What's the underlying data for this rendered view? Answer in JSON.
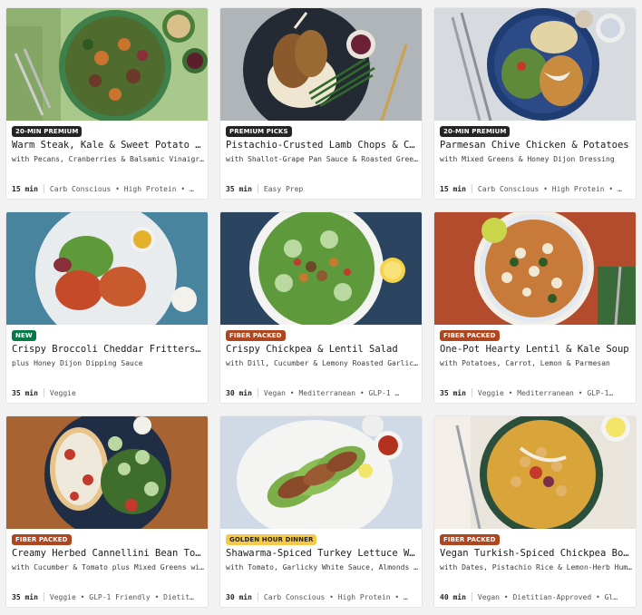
{
  "cards": [
    {
      "badge": "20-MIN PREMIUM",
      "badge_type": "premium",
      "title": "Warm Steak, Kale & Sweet Potato Salad",
      "subtitle": "with Pecans, Cranberries & Balsamic Vinaigrette",
      "time": "15 min",
      "tags": "Carb Conscious • High Protein • …",
      "image_icon": "salad-bowl-image"
    },
    {
      "badge": "PREMIUM PICKS",
      "badge_type": "premium",
      "title": "Pistachio-Crusted Lamb Chops & Cream…",
      "subtitle": "with Shallot-Grape Pan Sauce & Roasted Green Beans",
      "time": "35 min",
      "tags": "Easy Prep",
      "image_icon": "lamb-chops-plate-image"
    },
    {
      "badge": "20-MIN PREMIUM",
      "badge_type": "premium",
      "title": "Parmesan Chive Chicken & Potatoes",
      "subtitle": "with Mixed Greens & Honey Dijon Dressing",
      "time": "15 min",
      "tags": "Carb Conscious • High Protein • …",
      "image_icon": "chicken-potatoes-plate-image"
    },
    {
      "badge": "NEW",
      "badge_type": "new",
      "title": "Crispy Broccoli Cheddar Fritters with Ra…",
      "subtitle": "plus Honey Dijon Dipping Sauce",
      "time": "35 min",
      "tags": "Veggie",
      "image_icon": "fritters-plate-image"
    },
    {
      "badge": "FIBER PACKED",
      "badge_type": "fiber",
      "title": "Crispy Chickpea & Lentil Salad",
      "subtitle": "with Dill, Cucumber & Lemony Roasted Garlic Vinai…",
      "time": "30 min",
      "tags": "Vegan • Mediterranean • GLP-1 …",
      "image_icon": "chickpea-salad-bowl-image"
    },
    {
      "badge": "FIBER PACKED",
      "badge_type": "fiber",
      "title": "One-Pot Hearty Lentil & Kale Soup",
      "subtitle": "with Potatoes, Carrot, Lemon & Parmesan",
      "time": "35 min",
      "tags": "Veggie • Mediterranean • GLP-1…",
      "image_icon": "lentil-soup-bowl-image"
    },
    {
      "badge": "FIBER PACKED",
      "badge_type": "fiber",
      "title": "Creamy Herbed Cannellini Bean Toasts",
      "subtitle": "with Cucumber & Tomato plus Mixed Greens with Pi…",
      "time": "35 min",
      "tags": "Veggie • GLP-1 Friendly • Dietit…",
      "image_icon": "bean-toasts-plate-image"
    },
    {
      "badge": "GOLDEN HOUR DINNER",
      "badge_type": "golden",
      "title": "Shawarma-Spiced Turkey Lettuce Wraps",
      "subtitle": "with Tomato, Garlicky White Sauce, Almonds & Hot …",
      "time": "30 min",
      "tags": "Carb Conscious • High Protein • …",
      "image_icon": "lettuce-wraps-plate-image"
    },
    {
      "badge": "FIBER PACKED",
      "badge_type": "fiber",
      "title": "Vegan Turkish-Spiced Chickpea Bowls",
      "subtitle": "with Dates, Pistachio Rice & Lemon-Herb Hummus S…",
      "time": "40 min",
      "tags": "Vegan • Dietitian-Approved • Gl…",
      "image_icon": "chickpea-rice-bowl-image"
    }
  ]
}
